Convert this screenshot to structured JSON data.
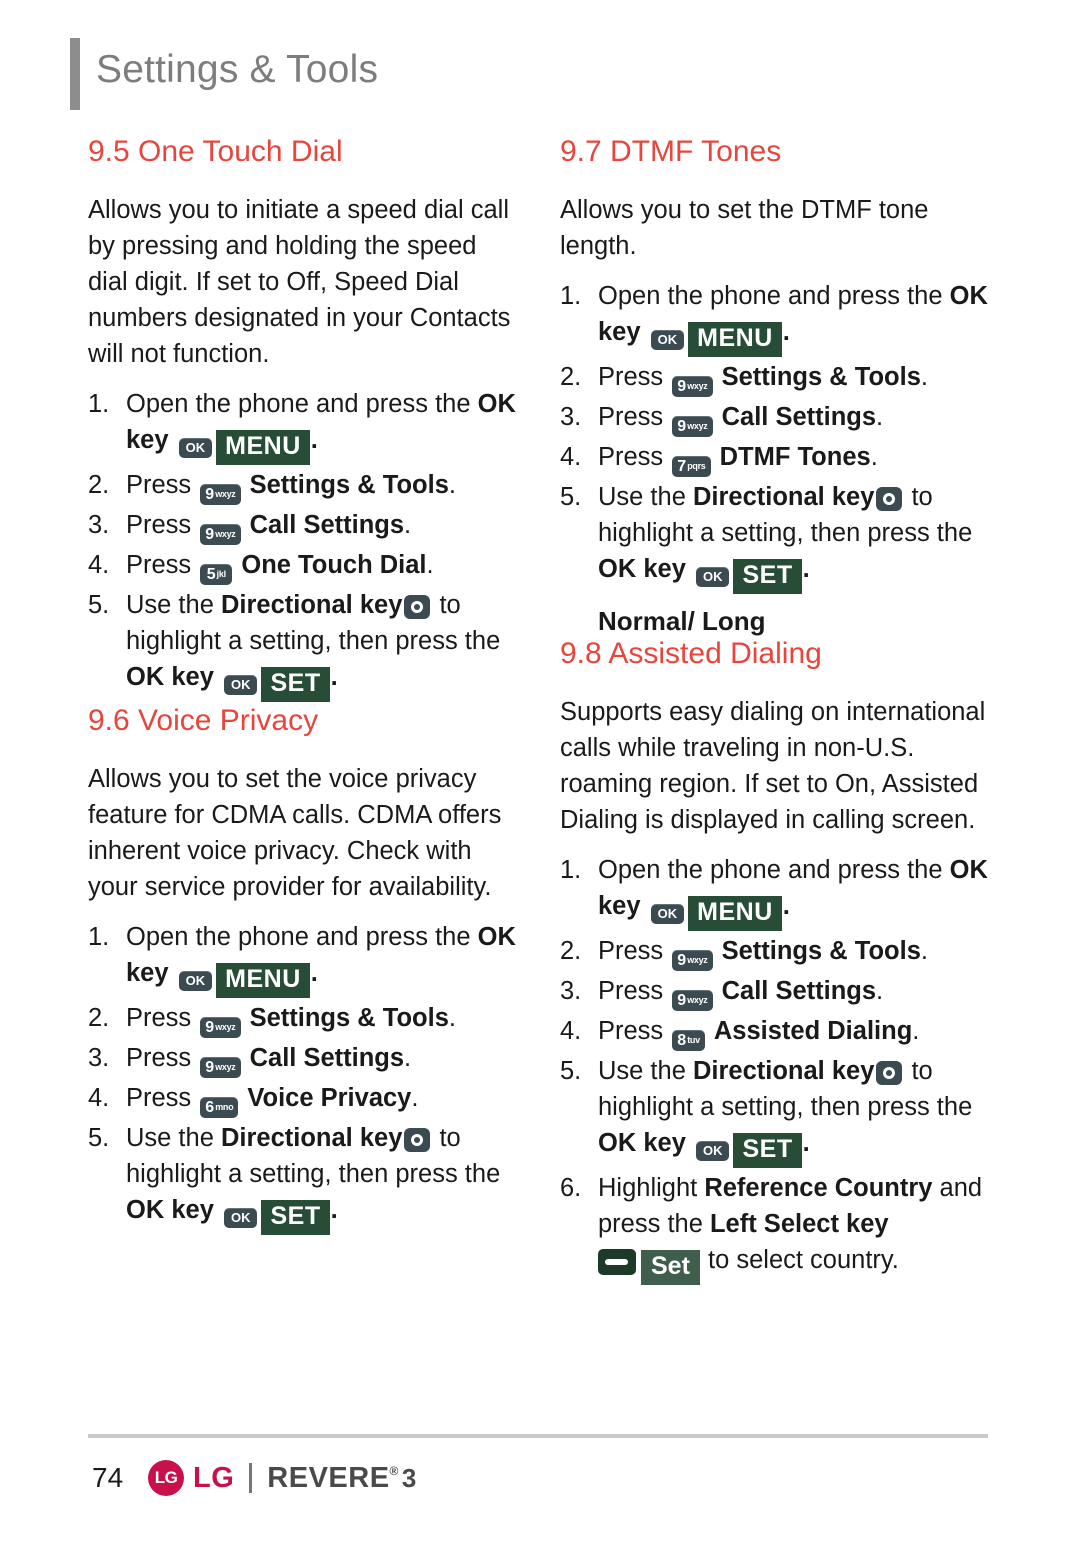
{
  "header": {
    "title": "Settings & Tools"
  },
  "left_column": {
    "sections": [
      {
        "heading": "9.5 One Touch Dial",
        "intro": "Allows you to initiate a speed dial call by pressing and holding the speed dial digit. If set to Off, Speed Dial numbers designated in your Contacts will not function.",
        "steps": [
          {
            "num": "1.",
            "pre": "Open the phone and press the ",
            "bold_a": "OK key",
            "key": "OK",
            "btn": "MENU",
            "post": "."
          },
          {
            "num": "2.",
            "pre": "Press ",
            "digit": "9",
            "sub": "wxyz",
            "bold_a": "Settings & Tools",
            "post": "."
          },
          {
            "num": "3.",
            "pre": "Press ",
            "digit": "9",
            "sub": "wxyz",
            "bold_a": "Call Settings",
            "post": "."
          },
          {
            "num": "4.",
            "pre": "Press ",
            "digit": "5",
            "sub": "jkl",
            "bold_a": "One Touch Dial",
            "post": "."
          },
          {
            "num": "5.",
            "pre": "Use the ",
            "bold_a": "Directional key",
            "mid": " to highlight a setting, then press the ",
            "bold_b": "OK key",
            "key": "OK",
            "btn": "SET",
            "post": "."
          }
        ]
      },
      {
        "heading": "9.6 Voice Privacy",
        "intro": "Allows you to set the voice privacy feature for CDMA calls. CDMA offers inherent voice privacy. Check with your service provider for availability.",
        "steps": [
          {
            "num": "1.",
            "pre": "Open the phone and press the ",
            "bold_a": "OK key",
            "key": "OK",
            "btn": "MENU",
            "post": "."
          },
          {
            "num": "2.",
            "pre": "Press ",
            "digit": "9",
            "sub": "wxyz",
            "bold_a": "Settings & Tools",
            "post": "."
          },
          {
            "num": "3.",
            "pre": "Press ",
            "digit": "9",
            "sub": "wxyz",
            "bold_a": "Call Settings",
            "post": "."
          },
          {
            "num": "4.",
            "pre": "Press ",
            "digit": "6",
            "sub": "mno",
            "bold_a": "Voice Privacy",
            "post": "."
          },
          {
            "num": "5.",
            "pre": "Use the ",
            "bold_a": "Directional key",
            "mid": " to highlight a setting, then press the ",
            "bold_b": "OK key",
            "key": "OK",
            "btn": "SET",
            "post": "."
          }
        ]
      }
    ]
  },
  "right_column": {
    "sections": [
      {
        "heading": "9.7 DTMF Tones",
        "intro": "Allows you to set the DTMF tone length.",
        "steps": [
          {
            "num": "1.",
            "pre": "Open the phone and press the ",
            "bold_a": "OK key",
            "key": "OK",
            "btn": "MENU",
            "post": "."
          },
          {
            "num": "2.",
            "pre": "Press ",
            "digit": "9",
            "sub": "wxyz",
            "bold_a": "Settings & Tools",
            "post": "."
          },
          {
            "num": "3.",
            "pre": "Press ",
            "digit": "9",
            "sub": "wxyz",
            "bold_a": "Call Settings",
            "post": "."
          },
          {
            "num": "4.",
            "pre": "Press ",
            "digit": "7",
            "sub": "pqrs",
            "bold_a": "DTMF Tones",
            "post": "."
          },
          {
            "num": "5.",
            "pre": "Use the ",
            "bold_a": "Directional key",
            "mid": " to highlight a setting, then press the ",
            "bold_b": "OK key",
            "key": "OK",
            "btn": "SET",
            "post": "."
          }
        ],
        "subhead": "Normal/ Long"
      },
      {
        "heading": "9.8 Assisted Dialing",
        "intro": "Supports easy dialing on international calls while traveling in non-U.S. roaming region. If set to On, Assisted Dialing is displayed in calling screen.",
        "steps": [
          {
            "num": "1.",
            "pre": "Open the phone and press the ",
            "bold_a": "OK key",
            "key": "OK",
            "btn": "MENU",
            "post": "."
          },
          {
            "num": "2.",
            "pre": "Press ",
            "digit": "9",
            "sub": "wxyz",
            "bold_a": "Settings & Tools",
            "post": "."
          },
          {
            "num": "3.",
            "pre": "Press ",
            "digit": "9",
            "sub": "wxyz",
            "bold_a": "Call Settings",
            "post": "."
          },
          {
            "num": "4.",
            "pre": "Press ",
            "digit": "8",
            "sub": "tuv",
            "bold_a": "Assisted Dialing",
            "post": "."
          },
          {
            "num": "5.",
            "pre": "Use the ",
            "bold_a": "Directional key",
            "mid": " to highlight a setting, then press the ",
            "bold_b": "OK key",
            "key": "OK",
            "btn": "SET",
            "post": "."
          },
          {
            "num": "6.",
            "pre": "Highlight ",
            "bold_a": "Reference Country",
            "mid": " and press the ",
            "bold_b": "Left Select key",
            "btn": "Set",
            "post": " to select country."
          }
        ]
      }
    ]
  },
  "footer": {
    "page_number": "74",
    "brand_mark": "LG",
    "brand_word": "LG",
    "model": "REVERE",
    "registered": "®",
    "model_number": "3"
  }
}
